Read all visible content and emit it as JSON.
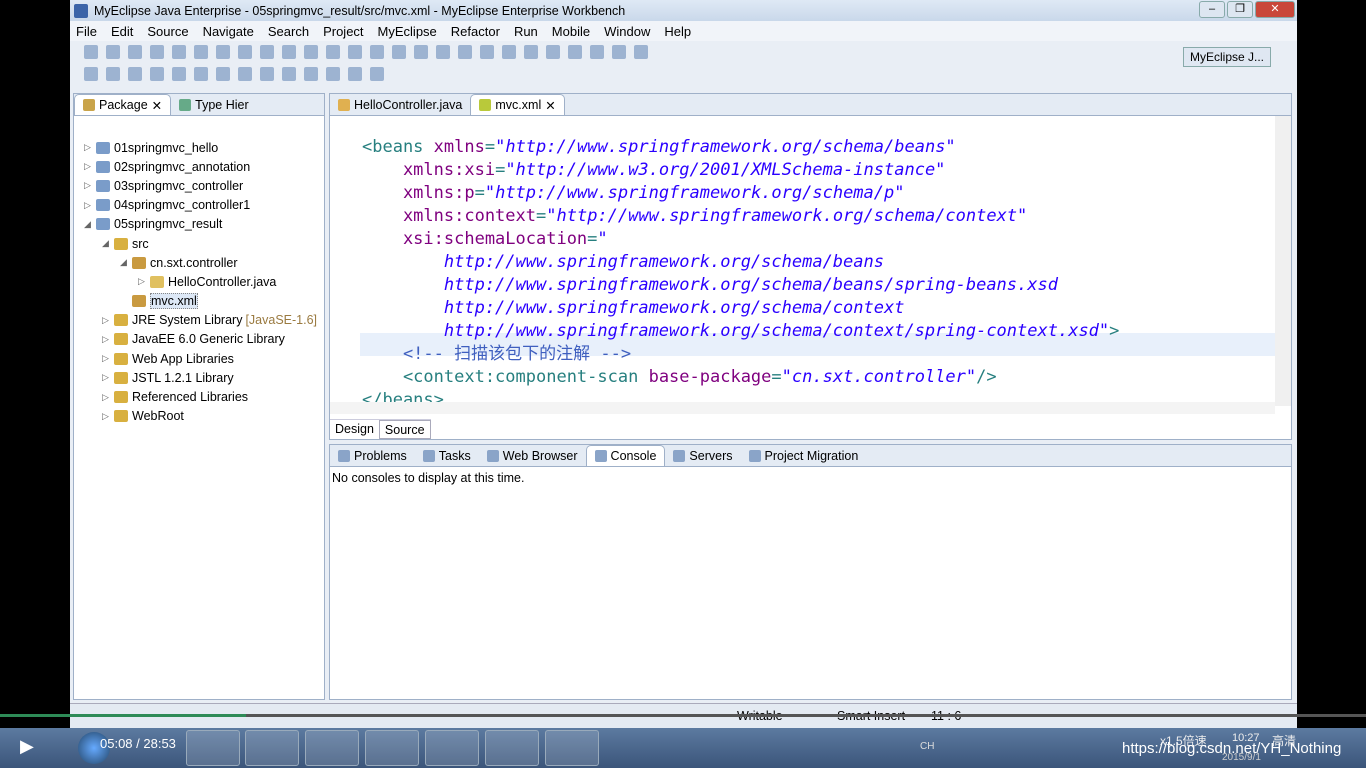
{
  "window": {
    "title": "MyEclipse Java Enterprise - 05springmvc_result/src/mvc.xml - MyEclipse Enterprise Workbench",
    "perspective": "MyEclipse J..."
  },
  "menu": [
    "File",
    "Edit",
    "Source",
    "Navigate",
    "Search",
    "Project",
    "MyEclipse",
    "Refactor",
    "Run",
    "Mobile",
    "Window",
    "Help"
  ],
  "left_panel": {
    "tabs": [
      "Package",
      "Type Hier"
    ],
    "tree": [
      {
        "label": "01springmvc_hello",
        "depth": 0,
        "arrow": "▷"
      },
      {
        "label": "02springmvc_annotation",
        "depth": 0,
        "arrow": "▷"
      },
      {
        "label": "03springmvc_controller",
        "depth": 0,
        "arrow": "▷"
      },
      {
        "label": "04springmvc_controller1",
        "depth": 0,
        "arrow": "▷"
      },
      {
        "label": "05springmvc_result",
        "depth": 0,
        "arrow": "◢"
      },
      {
        "label": "src",
        "depth": 1,
        "arrow": "◢"
      },
      {
        "label": "cn.sxt.controller",
        "depth": 2,
        "arrow": "◢"
      },
      {
        "label": "HelloController.java",
        "depth": 3,
        "arrow": "▷"
      },
      {
        "label": "mvc.xml",
        "depth": 2,
        "arrow": "",
        "selected": true
      },
      {
        "label": "JRE System Library",
        "extra": "[JavaSE-1.6]",
        "depth": 1,
        "arrow": "▷"
      },
      {
        "label": "JavaEE 6.0 Generic Library",
        "depth": 1,
        "arrow": "▷"
      },
      {
        "label": "Web App Libraries",
        "depth": 1,
        "arrow": "▷"
      },
      {
        "label": "JSTL 1.2.1 Library",
        "depth": 1,
        "arrow": "▷"
      },
      {
        "label": "Referenced Libraries",
        "depth": 1,
        "arrow": "▷"
      },
      {
        "label": "WebRoot",
        "depth": 1,
        "arrow": "▷"
      }
    ]
  },
  "editor": {
    "tabs": [
      "HelloController.java",
      "mvc.xml"
    ],
    "bottom_tabs": [
      "Design",
      "Source"
    ],
    "lines": [
      [
        [
          "tag",
          "<beans "
        ],
        [
          "att",
          "xmlns"
        ],
        [
          "tag",
          "="
        ],
        [
          "str",
          "\"http://www.springframework.org/schema/beans\""
        ]
      ],
      [
        [
          "att",
          "    xmlns:xsi"
        ],
        [
          "tag",
          "="
        ],
        [
          "str",
          "\"http://www.w3.org/2001/XMLSchema-instance\""
        ]
      ],
      [
        [
          "att",
          "    xmlns:p"
        ],
        [
          "tag",
          "="
        ],
        [
          "str",
          "\"http://www.springframework.org/schema/p\""
        ]
      ],
      [
        [
          "att",
          "    xmlns:context"
        ],
        [
          "tag",
          "="
        ],
        [
          "str",
          "\"http://www.springframework.org/schema/context\""
        ]
      ],
      [
        [
          "att",
          "    xsi:schemaLocation"
        ],
        [
          "tag",
          "="
        ],
        [
          "str",
          "\""
        ]
      ],
      [
        [
          "str",
          "        http://www.springframework.org/schema/beans"
        ]
      ],
      [
        [
          "str",
          "        http://www.springframework.org/schema/beans/spring-beans.xsd"
        ]
      ],
      [
        [
          "str",
          "        http://www.springframework.org/schema/context"
        ]
      ],
      [
        [
          "str",
          "        http://www.springframework.org/schema/context/spring-context.xsd\""
        ],
        [
          "tag",
          ">"
        ]
      ],
      [
        [
          "cmt",
          "    <!-- 扫描该包下的注解 -->"
        ]
      ],
      [
        [
          "tag",
          "    <context:component-scan "
        ],
        [
          "att",
          "base-package"
        ],
        [
          "tag",
          "="
        ],
        [
          "str",
          "\"cn.sxt.controller\""
        ],
        [
          "tag",
          "/>"
        ]
      ],
      [
        [
          "tag",
          "</beans>"
        ]
      ]
    ]
  },
  "console": {
    "tabs": [
      "Problems",
      "Tasks",
      "Web Browser",
      "Console",
      "Servers",
      "Project Migration"
    ],
    "message": "No consoles to display at this time."
  },
  "status": {
    "mode": "Writable",
    "insert": "Smart Insert",
    "position": "11 : 6"
  },
  "player": {
    "time": "05:08 / 28:53",
    "speed": "x1.5倍速",
    "quality": "高清",
    "progress": 0.18
  },
  "taskbar": {
    "clock": "10:27",
    "date": "2015/9/1",
    "watermark": "https://blog.csdn.net/YH_Nothing",
    "lang": "CH"
  }
}
